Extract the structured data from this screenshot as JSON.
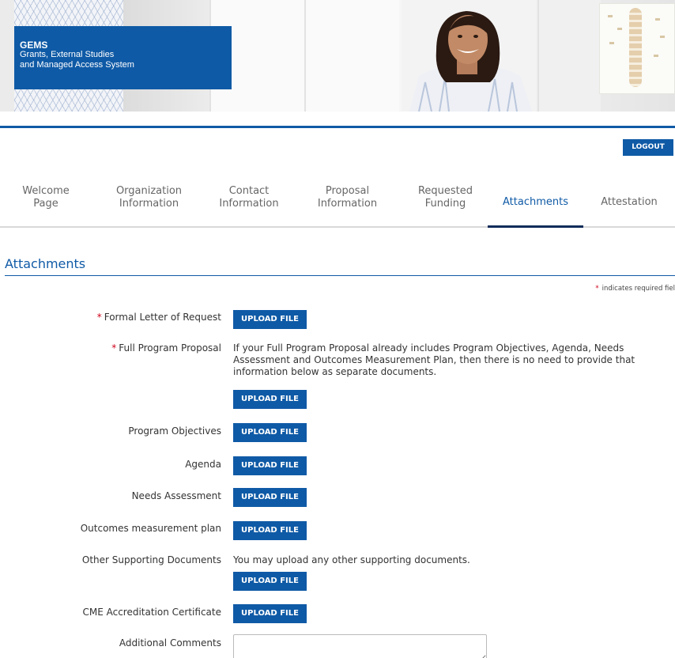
{
  "brand": {
    "title": "GEMS",
    "subtitle_line1": "Grants, External Studies",
    "subtitle_line2": "and Managed Access System"
  },
  "header": {
    "logout_label": "LOGOUT"
  },
  "tabs": [
    {
      "line1": "Welcome",
      "line2": "Page",
      "active": false
    },
    {
      "line1": "Organization",
      "line2": "Information",
      "active": false
    },
    {
      "line1": "Contact",
      "line2": "Information",
      "active": false
    },
    {
      "line1": "Proposal",
      "line2": "Information",
      "active": false
    },
    {
      "line1": "Requested",
      "line2": "Funding",
      "active": false
    },
    {
      "line1": "Attachments",
      "line2": "",
      "active": true
    },
    {
      "line1": "Attestation",
      "line2": "",
      "active": false
    }
  ],
  "section": {
    "title": "Attachments",
    "required_note": "indicates required fiel"
  },
  "form": {
    "upload_label": "UPLOAD FILE",
    "fields": [
      {
        "label": "Formal Letter of Request",
        "required": true
      },
      {
        "label": "Full Program Proposal",
        "required": true,
        "help": "If your Full Program Proposal already includes Program Objectives, Agenda, Needs Assessment and Outcomes Measurement Plan, then there is no need to provide that information below as separate documents."
      },
      {
        "label": "Program Objectives",
        "required": false
      },
      {
        "label": "Agenda",
        "required": false
      },
      {
        "label": "Needs Assessment",
        "required": false
      },
      {
        "label": "Outcomes measurement plan",
        "required": false
      },
      {
        "label": "Other Supporting Documents",
        "required": false,
        "help": "You may upload any other supporting documents."
      },
      {
        "label": "CME Accreditation Certificate",
        "required": false
      },
      {
        "label": "Additional Comments",
        "required": false
      }
    ]
  },
  "colors": {
    "brand_blue": "#0f5aa6",
    "tab_underline": "#0f2c5a",
    "required_star": "#d0021b"
  }
}
